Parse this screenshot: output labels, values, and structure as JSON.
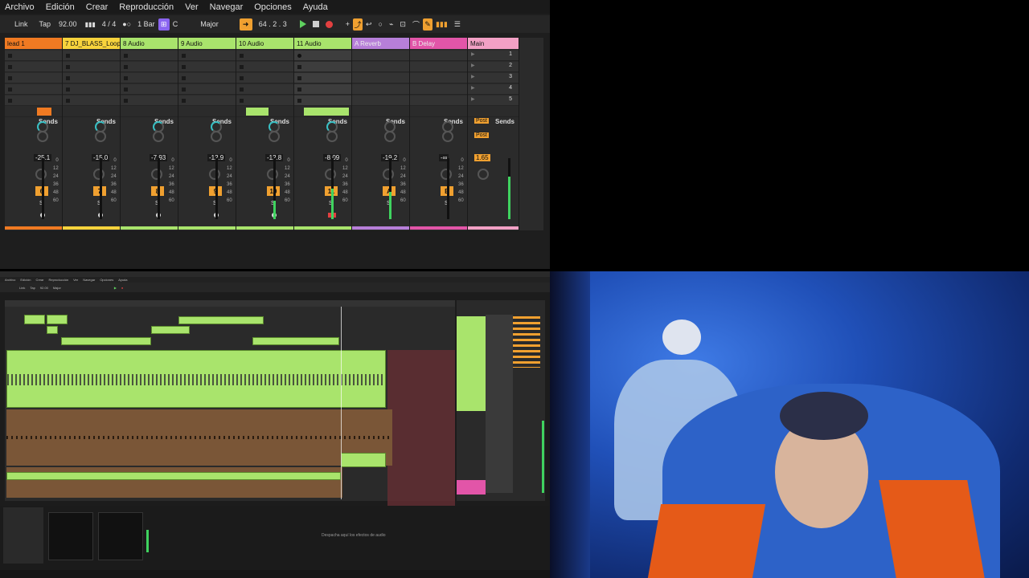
{
  "menu": [
    "Archivo",
    "Edición",
    "Crear",
    "Reproducción",
    "Ver",
    "Navegar",
    "Opciones",
    "Ayuda"
  ],
  "transport": {
    "link": "Link",
    "tap": "Tap",
    "tempo": "92.00",
    "signature": "4 / 4",
    "quantize": "1 Bar",
    "key": "C",
    "scale": "Major",
    "position": "64 . 2 . 3"
  },
  "tracks": [
    {
      "name": "lead 1",
      "num": "6",
      "volume": "-25.1",
      "color": "#f07a22",
      "head_text": "#111",
      "sends": "Sends"
    },
    {
      "name": "7 DJ_BLASS_Loop",
      "num": "7",
      "volume": "-15.0",
      "color": "#f7d33c",
      "head_text": "#111",
      "sends": "Sends"
    },
    {
      "name": "8 Audio",
      "num": "8",
      "volume": "-7.93",
      "color": "#a9e46c",
      "head_text": "#111",
      "sends": "Sends"
    },
    {
      "name": "9 Audio",
      "num": "9",
      "volume": "-12.9",
      "color": "#a9e46c",
      "head_text": "#111",
      "sends": "Sends"
    },
    {
      "name": "10 Audio",
      "num": "10",
      "volume": "-12.8",
      "color": "#a9e46c",
      "head_text": "#111",
      "sends": "Sends"
    },
    {
      "name": "11 Audio",
      "num": "11",
      "volume": "-8.09",
      "color": "#a9e46c",
      "head_text": "#111",
      "sends": "Sends"
    },
    {
      "name": "A Reverb",
      "num": "A",
      "volume": "-19.2",
      "color": "#b77fd9",
      "head_text": "#eee",
      "sends": "Sends"
    },
    {
      "name": "B Delay",
      "num": "B",
      "volume": "-∞",
      "color": "#e255a8",
      "head_text": "#eee",
      "sends": "Sends"
    },
    {
      "name": "Main",
      "num": "",
      "volume": "1.65",
      "color": "#f2a0c5",
      "head_text": "#111",
      "sends": "Sends"
    }
  ],
  "scene_numbers": [
    "1",
    "2",
    "3",
    "4",
    "5"
  ],
  "sends_letters": {
    "a": "A",
    "b": "B"
  },
  "post_label": "Post",
  "solo_label": "S",
  "scale_labels": [
    "0",
    "12",
    "24",
    "36",
    "48",
    "60"
  ],
  "bottom": {
    "drop_hint": "Despacha aquí los efectos de audio"
  },
  "colors": {
    "audio_green": "#a9e46c",
    "orange": "#f07a22",
    "yellow": "#f7d33c",
    "purple": "#b77fd9",
    "pink": "#e255a8",
    "record": "#e34040",
    "play": "#5fd15f"
  }
}
